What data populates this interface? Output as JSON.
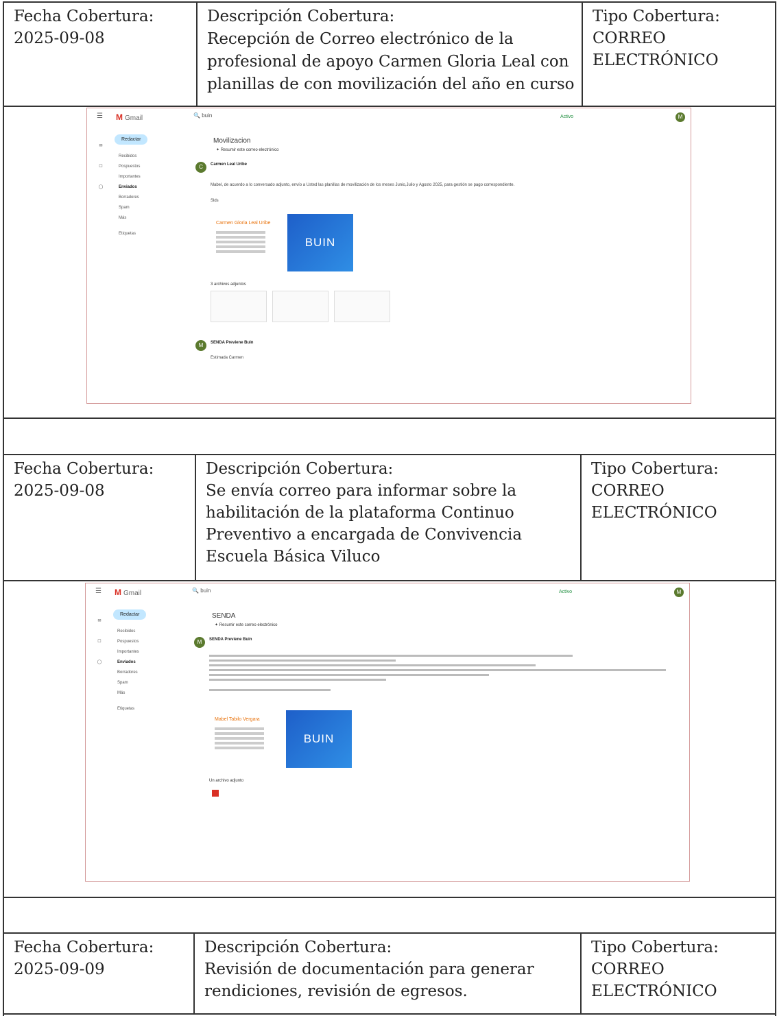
{
  "rows": [
    {
      "fecha_label": "Fecha Cobertura:",
      "fecha": "2025-09-08",
      "desc_label": "Descripción Cobertura:",
      "desc": "Recepción de Correo electrónico de la profesional de apoyo Carmen Gloria Leal con planillas de con movilización del año en curso",
      "tipo_label": "Tipo Cobertura:",
      "tipo": "CORREO ELECTRÓNICO"
    },
    {
      "fecha_label": "Fecha Cobertura:",
      "fecha": "2025-09-08",
      "desc_label": "Descripción Cobertura:",
      "desc": "Se envía correo para informar sobre la habilitación de la plataforma Continuo Preventivo a encargada de Convivencia Escuela Básica Viluco",
      "tipo_label": "Tipo Cobertura:",
      "tipo": "CORREO ELECTRÓNICO"
    },
    {
      "fecha_label": "Fecha Cobertura:",
      "fecha": "2025-09-09",
      "desc_label": "Descripción Cobertura:",
      "desc": "Revisión de documentación para generar rendiciones, revisión de egresos.",
      "tipo_label": "Tipo Cobertura:",
      "tipo": "CORREO ELECTRÓNICO"
    }
  ],
  "shots": [
    {
      "app": "Gmail",
      "search": "buin",
      "active": "Activo",
      "avatar": "M",
      "compose": "Redactar",
      "nav": [
        "Recibidos",
        "Pospuestos",
        "Importantes",
        "Enviados",
        "Borradores",
        "Spam",
        "Más"
      ],
      "labels_title": "Etiquetas",
      "subject": "Movilizacion",
      "summary": "Resumir este correo electrónico",
      "sender": "Carmen Leal Uribe",
      "sender_initial": "C",
      "body": "Mabel, de acuerdo a lo conversado adjunto, envío a Usted las planillas de movilización de los meses Junio,Julio y Agosto 2025, para gestión se pago correspondiente.",
      "greeting": "Slds",
      "sig_name": "Carmen Gloria Leal Uribe",
      "brand": "BUIN",
      "attachments": "3 archivos adjuntos",
      "next_sender": "SENDA Previene Buin",
      "next_initial": "M",
      "next_line": "Estimada Carmen"
    },
    {
      "app": "Gmail",
      "search": "buin",
      "active": "Activo",
      "avatar": "M",
      "compose": "Redactar",
      "nav": [
        "Recibidos",
        "Pospuestos",
        "Importantes",
        "Enviados",
        "Borradores",
        "Spam",
        "Más"
      ],
      "labels_title": "Etiquetas",
      "subject": "SENDA",
      "summary": "Resumir este correo electrónico",
      "sender": "SENDA Previene Buin",
      "sender_initial": "M",
      "sig_name": "Mabel Tabilo Vergara",
      "brand": "BUIN",
      "attachments": "Un archivo adjunto"
    }
  ]
}
